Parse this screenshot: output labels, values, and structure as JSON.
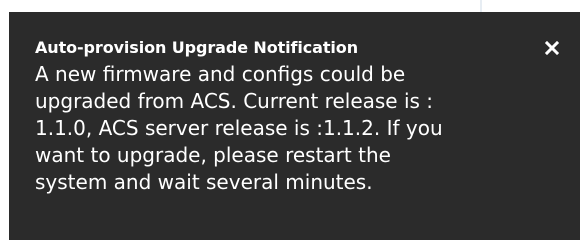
{
  "notification": {
    "title": "Auto-provision Upgrade Notification",
    "message_lines": [
      "A new firmware and configs could be",
      "upgraded from ACS. Current release is :",
      "1.1.0, ACS server release is :1.1.2. If you",
      "want to upgrade, please restart the",
      "system and wait several minutes."
    ],
    "close_icon": "close-icon",
    "background_color": "#2b2b2b",
    "text_color": "#ffffff"
  }
}
